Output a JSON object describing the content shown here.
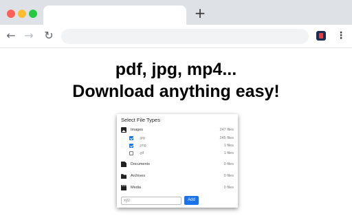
{
  "browser": {
    "new_tab_glyph": "+",
    "back_glyph": "←",
    "forward_glyph": "→",
    "reload_glyph": "↻",
    "menu_glyph": "⋮"
  },
  "headline": {
    "line1": "pdf, jpg, mp4...",
    "line2": "Download anything easy!"
  },
  "panel": {
    "title": "Select File Types",
    "groups": [
      {
        "label": "Images",
        "count": "247 files",
        "icon": "image-icon",
        "items": [
          {
            "label": ".jpg",
            "count": "245 files",
            "checked": true
          },
          {
            "label": ".png",
            "count": "1 files",
            "checked": true
          },
          {
            "label": ".gif",
            "count": "1 files",
            "checked": false
          }
        ]
      },
      {
        "label": "Documents",
        "count": "0 files",
        "icon": "document-icon"
      },
      {
        "label": "Archives",
        "count": "0 files",
        "icon": "archive-icon"
      },
      {
        "label": "Media",
        "count": "0 files",
        "icon": "media-icon"
      }
    ],
    "input_placeholder": "xyz",
    "add_label": "Add"
  },
  "colors": {
    "accent": "#1a73e8",
    "tabbar": "#dee1e6"
  }
}
